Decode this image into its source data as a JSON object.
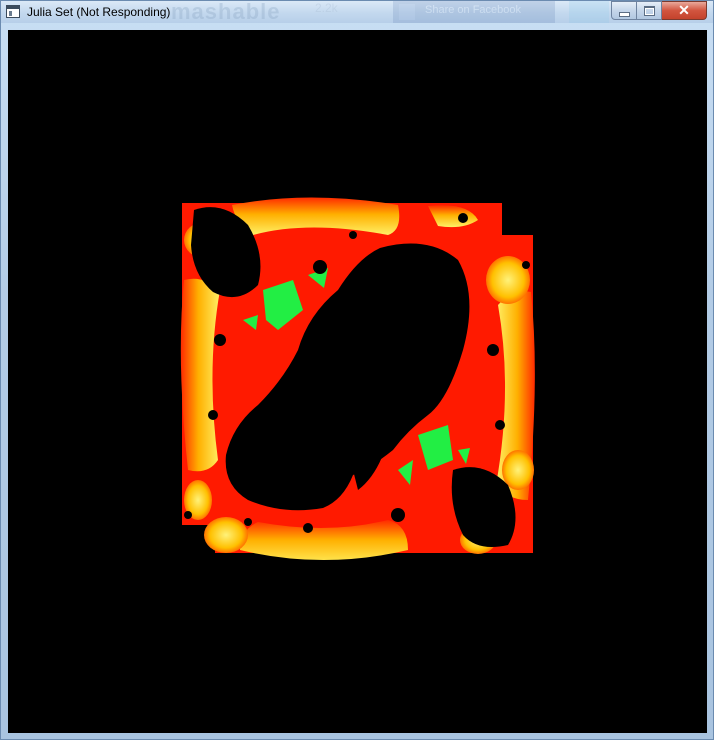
{
  "window": {
    "title": "Julia Set (Not Responding)"
  },
  "background_ghost": {
    "brand_text": "mashable",
    "share_count": "2.2k",
    "facebook_label": "Share on Facebook"
  },
  "controls": {
    "minimize_icon": "minimize-icon",
    "maximize_icon": "maximize-icon",
    "close_icon": "close-icon",
    "close_glyph": "✕"
  },
  "colors": {
    "background": "#000000",
    "red": "#ff1a00",
    "yellow": "#ffe84a",
    "orange": "#ffb800",
    "green": "#22ee44",
    "close_button": "#c4432c"
  }
}
